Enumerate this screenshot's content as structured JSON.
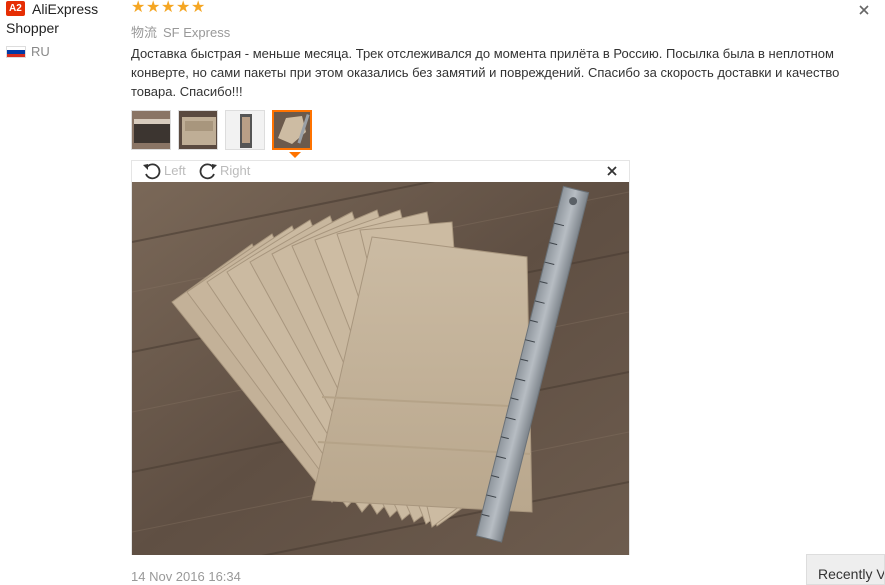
{
  "reviewer": {
    "badge": "A2",
    "name": "AliExpress Shopper",
    "country": "RU",
    "flag_colors": [
      "#ffffff",
      "#0039a6",
      "#d52b1e"
    ]
  },
  "review": {
    "rating": 5,
    "stars": "★★★★★",
    "logistics_label": "物流",
    "logistics_value": "SF Express",
    "text": "Доставка быстрая - меньше месяца. Трек отслеживался до момента прилёта в Россию. Посылка была в неплотном конверте, но сами пакеты при этом оказались без замятий и повреждений. Спасибо за скорость доставки и качество товара. Спасибо!!!",
    "date": "14 Nov 2016 16:34"
  },
  "thumbnails": [
    {
      "icon": "photo-thumb-1",
      "active": false
    },
    {
      "icon": "photo-thumb-2",
      "active": false
    },
    {
      "icon": "photo-thumb-3",
      "active": false
    },
    {
      "icon": "photo-thumb-4",
      "active": true
    }
  ],
  "viewer": {
    "rotate_left_label": "Left",
    "rotate_right_label": "Right",
    "photo_icon": "kraft-paper-bags-with-ruler"
  },
  "recently_viewed_label": "Recently Viewed",
  "colors": {
    "accent": "#ff7300",
    "star": "#f5a623",
    "badge": "#e62e04",
    "wood": "#6b5a4c",
    "kraft": "#c9b89f"
  }
}
